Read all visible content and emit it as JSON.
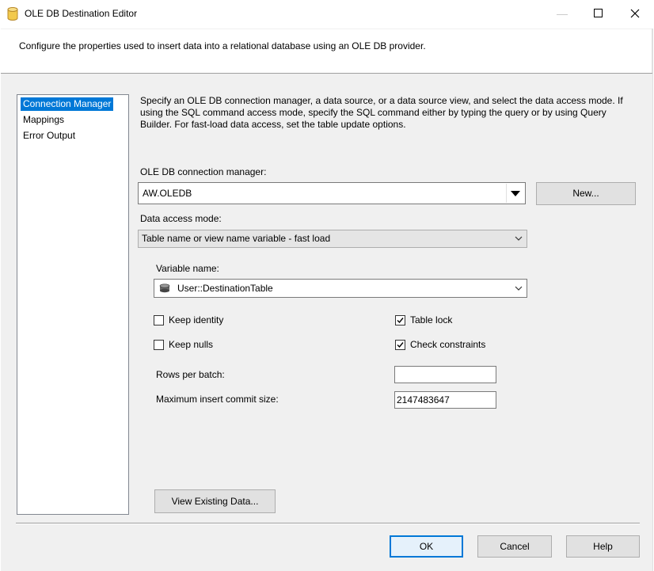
{
  "window": {
    "title": "OLE DB Destination Editor",
    "icon": "cylinder-database-icon",
    "controls": {
      "minimize": "—",
      "maximize": "☐",
      "close": "✕"
    }
  },
  "header": {
    "description": "Configure the properties used to insert data into a relational database using an OLE DB provider."
  },
  "nav": {
    "items": [
      {
        "label": "Connection Manager",
        "selected": true
      },
      {
        "label": "Mappings",
        "selected": false
      },
      {
        "label": "Error Output",
        "selected": false
      }
    ]
  },
  "main": {
    "description": "Specify an OLE DB connection manager, a data source, or a data source view, and select the data access mode. If using the SQL command access mode, specify the SQL command either by typing the query or by using Query Builder. For fast-load data access, set the table update options.",
    "connection_manager_label": "OLE DB connection manager:",
    "connection_manager_value": "AW.OLEDB",
    "new_button": "New...",
    "data_access_mode_label": "Data access mode:",
    "data_access_mode_value": "Table name or view name variable - fast load",
    "variable_name_label": "Variable name:",
    "variable_name_value": "User::DestinationTable",
    "keep_identity": {
      "label": "Keep identity",
      "checked": false
    },
    "keep_nulls": {
      "label": "Keep nulls",
      "checked": false
    },
    "table_lock": {
      "label": "Table lock",
      "checked": true
    },
    "check_constraints": {
      "label": "Check constraints",
      "checked": true
    },
    "rows_per_batch_label": "Rows per batch:",
    "rows_per_batch_value": "",
    "max_commit_label": "Maximum insert commit size:",
    "max_commit_value": "2147483647",
    "view_existing_button": "View Existing Data..."
  },
  "footer": {
    "ok": "OK",
    "cancel": "Cancel",
    "help": "Help"
  },
  "colors": {
    "selection": "#0078d7",
    "dialog_bg": "#f0f0f0"
  }
}
